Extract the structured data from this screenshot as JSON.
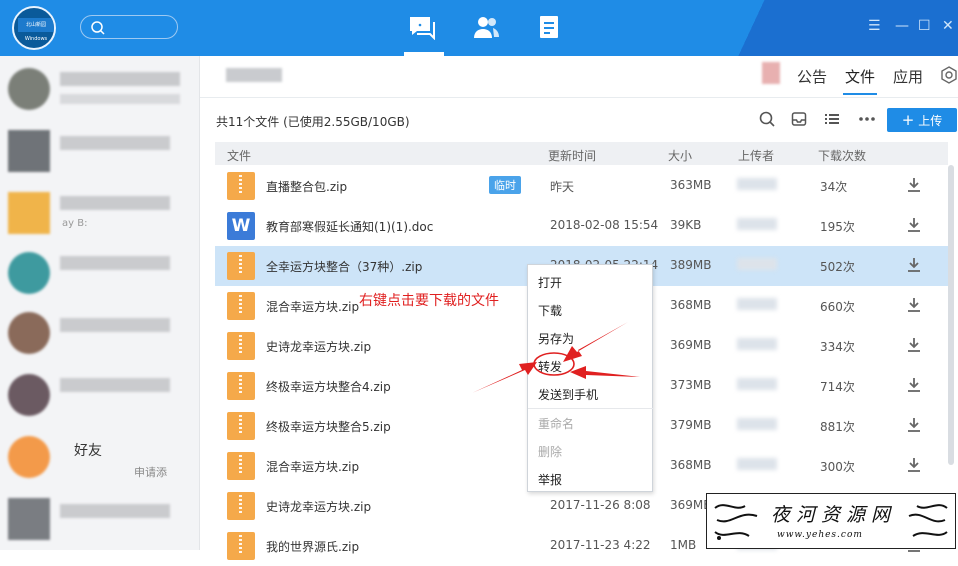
{
  "group": {
    "tabs": [
      {
        "label": "公告"
      },
      {
        "label": "文件"
      },
      {
        "label": "应用"
      }
    ]
  },
  "files": {
    "summary": "共11个文件 (已使用2.55GB/10GB)",
    "upload_label": "上传",
    "columns": [
      "文件",
      "更新时间",
      "大小",
      "上传者",
      "下载次数"
    ],
    "rows": [
      {
        "name": "直播整合包.zip",
        "type": "zip",
        "badge": "临时",
        "date": "昨天",
        "size": "363MB",
        "count": "34次"
      },
      {
        "name": "教育部寒假延长通知(1)(1).doc",
        "type": "doc",
        "date": "2018-02-08 15:54",
        "size": "39KB",
        "count": "195次"
      },
      {
        "name": "全幸运方块整合（37种）.zip",
        "type": "zip",
        "date": "2018-02-05 22:14",
        "size": "389MB",
        "count": "502次"
      },
      {
        "name": "混合幸运方块.zip",
        "type": "zip",
        "date": "",
        "size": "368MB",
        "count": "660次"
      },
      {
        "name": "史诗龙幸运方块.zip",
        "type": "zip",
        "date": "",
        "size": "369MB",
        "count": "334次"
      },
      {
        "name": "终极幸运方块整合4.zip",
        "type": "zip",
        "date": "",
        "size": "373MB",
        "count": "714次"
      },
      {
        "name": "终极幸运方块整合5.zip",
        "type": "zip",
        "date": "",
        "size": "379MB",
        "count": "881次"
      },
      {
        "name": "混合幸运方块.zip",
        "type": "zip",
        "date": "",
        "size": "368MB",
        "count": "300次"
      },
      {
        "name": "史诗龙幸运方块.zip",
        "type": "zip",
        "date": "2017-11-26 8:08",
        "size": "369MB",
        "count": "206次"
      },
      {
        "name": "我的世界源氏.zip",
        "type": "zip",
        "date": "2017-11-23 4:22",
        "size": "1MB",
        "count": ""
      }
    ]
  },
  "context_menu": {
    "items": [
      "打开",
      "下载",
      "另存为",
      "转发",
      "发送到手机"
    ],
    "disabled_items": [
      "重命名",
      "删除"
    ],
    "last_item": "举报"
  },
  "annotation": "右键点击要下载的文件",
  "sidebar": {
    "fragments": [
      "好友",
      "申请添",
      "ay B:"
    ]
  },
  "avatar_text": "北山新园 Windows",
  "watermark": {
    "title": "夜河资源网",
    "url": "www.yehes.com"
  },
  "colors": {
    "accent": "#1f8ce6",
    "selected_row": "#cde4f8",
    "annotation": "#e02020"
  },
  "icons": [
    "search-icon",
    "chat-icon",
    "contacts-icon",
    "files-icon",
    "menu-icon",
    "minimize-icon",
    "maximize-icon",
    "close-icon",
    "inbox-icon",
    "list-icon",
    "more-icon",
    "download-icon",
    "settings-icon"
  ]
}
